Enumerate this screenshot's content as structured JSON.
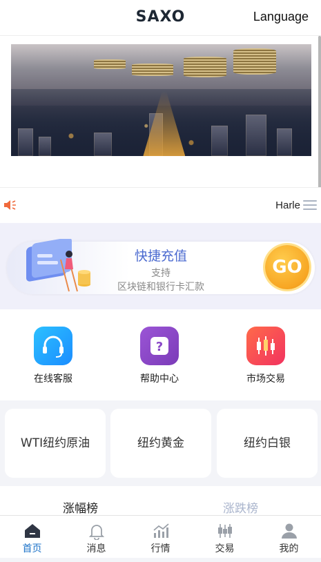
{
  "header": {
    "brand": "SAXO",
    "language_label": "Language"
  },
  "notice": {
    "text": "Harle"
  },
  "recharge": {
    "title": "快捷充值",
    "subtitle_line1": "支持",
    "subtitle_line2": "区块链和银行卡汇款",
    "go_label": "GO"
  },
  "quick_links": [
    {
      "label": "在线客服",
      "icon": "headset-icon",
      "color": "#1b8dff"
    },
    {
      "label": "帮助中心",
      "icon": "question-icon",
      "color": "#7b3bb8"
    },
    {
      "label": "市场交易",
      "icon": "candlestick-icon",
      "color": "#f2335f"
    }
  ],
  "markets": [
    {
      "label": "WTI纽约原油"
    },
    {
      "label": "纽约黄金"
    },
    {
      "label": "纽约白银"
    }
  ],
  "tabs": [
    {
      "label": "涨幅榜",
      "active": true
    },
    {
      "label": "涨跌榜",
      "active": false
    }
  ],
  "bottom_nav": [
    {
      "label": "首页",
      "icon": "home-icon",
      "active": true
    },
    {
      "label": "消息",
      "icon": "bell-icon",
      "active": false
    },
    {
      "label": "行情",
      "icon": "chart-icon",
      "active": false
    },
    {
      "label": "交易",
      "icon": "candlestick-icon",
      "active": false
    },
    {
      "label": "我的",
      "icon": "user-icon",
      "active": false
    }
  ],
  "colors": {
    "accent_blue": "#1e73c8",
    "recharge_title": "#4c6bd0",
    "go_orange": "#f7a623",
    "inactive_tab": "#a9b4cc"
  }
}
